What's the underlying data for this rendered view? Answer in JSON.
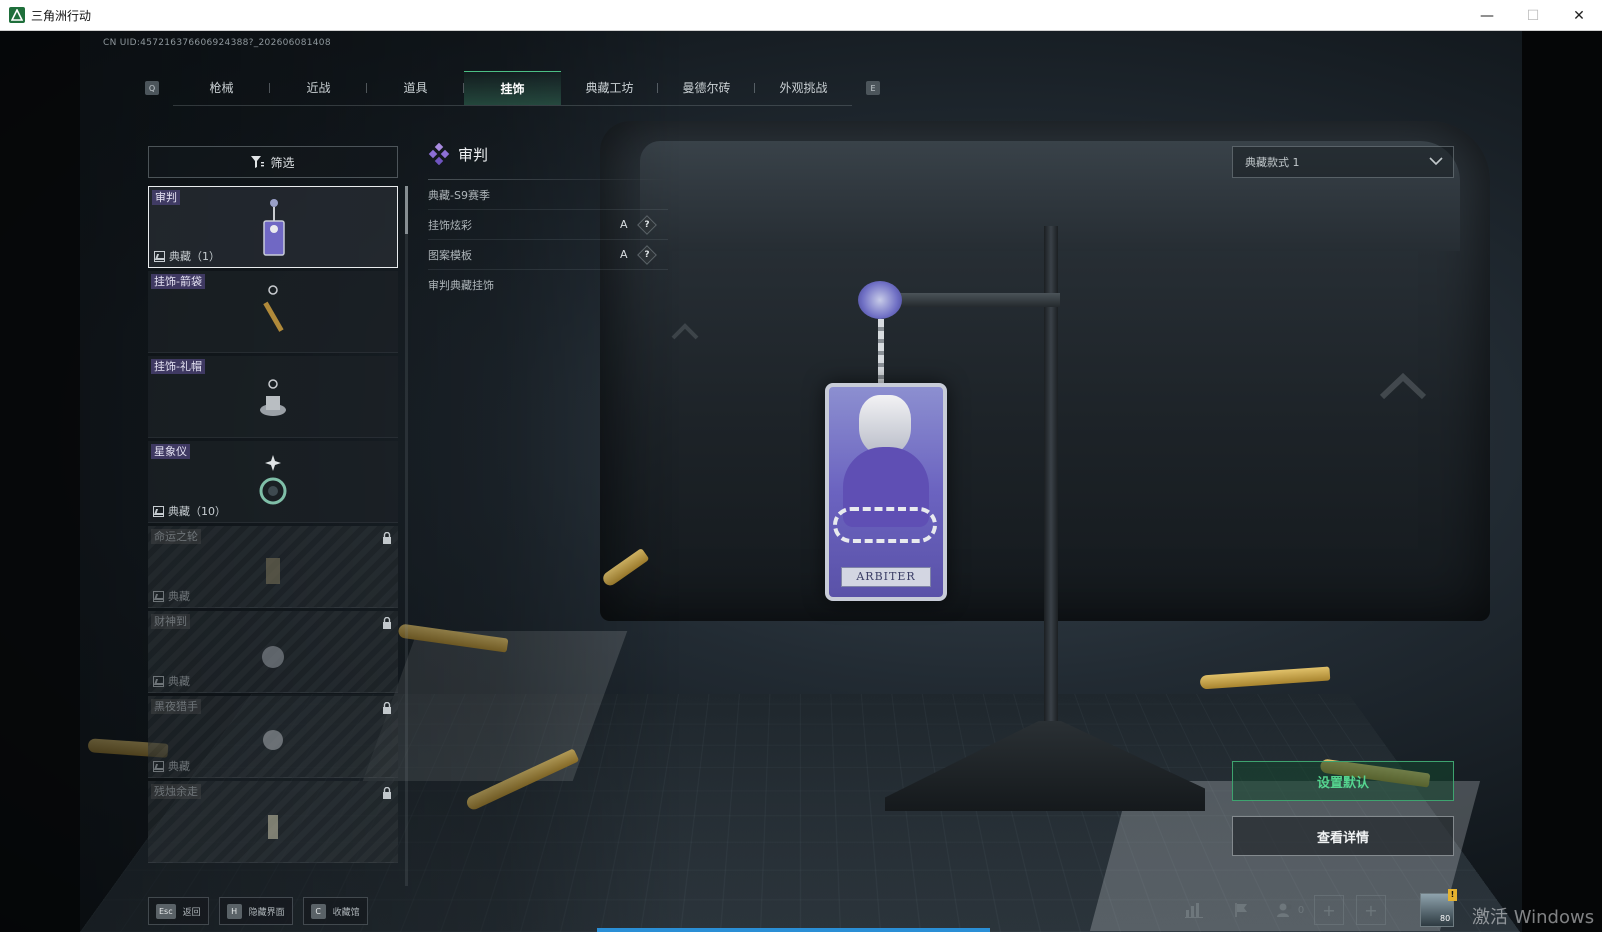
{
  "window": {
    "title": "三角洲行动",
    "minimize": "—",
    "maximize": "☐",
    "close": "✕"
  },
  "uid": "CN UID:457216376606924388?_202606081408",
  "tabs": {
    "prev_key": "Q",
    "next_key": "E",
    "items": [
      {
        "label": "枪械"
      },
      {
        "label": "近战"
      },
      {
        "label": "道具"
      },
      {
        "label": "挂饰",
        "active": true
      },
      {
        "label": "典藏工坊"
      },
      {
        "label": "曼德尔砖"
      },
      {
        "label": "外观挑战"
      }
    ]
  },
  "filter": {
    "label": "筛选"
  },
  "list": {
    "items": [
      {
        "name": "审判",
        "sub": "典藏（1）",
        "selected": true,
        "locked": false
      },
      {
        "name": "挂饰-箭袋",
        "sub": "",
        "selected": false,
        "locked": false
      },
      {
        "name": "挂饰-礼帽",
        "sub": "",
        "selected": false,
        "locked": false
      },
      {
        "name": "星象仪",
        "sub": "典藏（10）",
        "selected": false,
        "locked": false
      },
      {
        "name": "命运之轮",
        "sub": "典藏",
        "selected": false,
        "locked": true
      },
      {
        "name": "财神到",
        "sub": "典藏",
        "selected": false,
        "locked": true
      },
      {
        "name": "黑夜猎手",
        "sub": "典藏",
        "selected": false,
        "locked": true
      },
      {
        "name": "残烛余走",
        "sub": "",
        "selected": false,
        "locked": true
      }
    ]
  },
  "detail": {
    "title": "审判",
    "season": "典藏-S9赛季",
    "rows": [
      {
        "label": "挂饰炫彩",
        "grade": "A",
        "help": "?"
      },
      {
        "label": "图案模板",
        "grade": "A",
        "help": "?"
      }
    ],
    "description": "审判典藏挂饰"
  },
  "charm_card_text": "ARBITER",
  "style_select": {
    "value": "典藏款式 1"
  },
  "actions": {
    "set_default": "设置默认",
    "view_details": "查看详情"
  },
  "footer": {
    "keys": [
      {
        "key": "Esc",
        "label": "返回"
      },
      {
        "key": "H",
        "label": "隐藏界面"
      },
      {
        "key": "C",
        "label": "收藏馆"
      }
    ]
  },
  "status": {
    "friends_count": "0",
    "avatar_level": "80",
    "avatar_badge": "!"
  },
  "watermark": "激活 Windows",
  "colors": {
    "accent_green": "#55d48f",
    "tab_active": "#4cbf85",
    "charm_purple": "#6b63c0"
  }
}
